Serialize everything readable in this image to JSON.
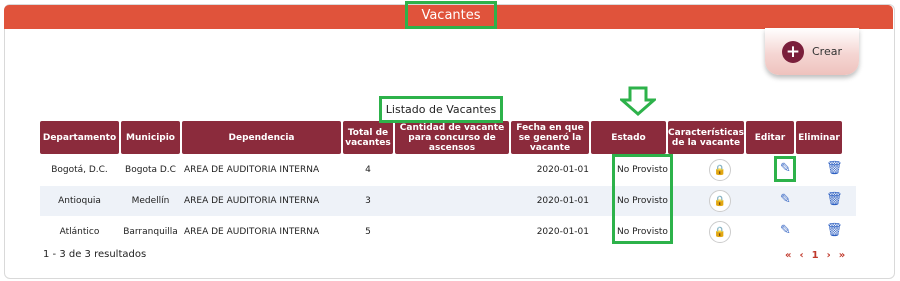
{
  "header": {
    "title": "Vacantes"
  },
  "toolbar": {
    "create_label": "Crear",
    "create_icon": "plus-icon"
  },
  "table": {
    "caption": "Listado de Vacantes",
    "columns": [
      "Departamento",
      "Municipio",
      "Dependencia",
      "Total de vacantes",
      "Cantidad de vacante para concurso de ascensos",
      "Fecha en que se generó la vacante",
      "Estado",
      "Características de la vacante",
      "Editar",
      "Eliminar"
    ],
    "rows": [
      {
        "departamento": "Bogotá, D.C.",
        "municipio": "Bogota D.C",
        "dependencia": "AREA DE AUDITORIA INTERNA",
        "total": "4",
        "cantidad": "",
        "fecha": "2020-01-01",
        "estado": "No Provisto"
      },
      {
        "departamento": "Antioquia",
        "municipio": "Medellín",
        "dependencia": "AREA DE AUDITORIA INTERNA",
        "total": "3",
        "cantidad": "",
        "fecha": "2020-01-01",
        "estado": "No Provisto"
      },
      {
        "departamento": "Atlántico",
        "municipio": "Barranquilla",
        "dependencia": "AREA DE AUDITORIA INTERNA",
        "total": "5",
        "cantidad": "",
        "fecha": "2020-01-01",
        "estado": "No Provisto"
      }
    ],
    "row_icons": {
      "characteristics": "lock-icon",
      "edit": "pencil-icon",
      "delete": "trash-icon"
    }
  },
  "footer": {
    "results_text": "1 - 3 de 3 resultados"
  },
  "pagination": {
    "first": "«",
    "prev": "‹",
    "current": "1",
    "next": "›",
    "last": "»"
  },
  "colors": {
    "topbar": "#e0533b",
    "table_header": "#8b2b3c",
    "highlight": "#2db24a",
    "accent": "#7a1f3b"
  }
}
